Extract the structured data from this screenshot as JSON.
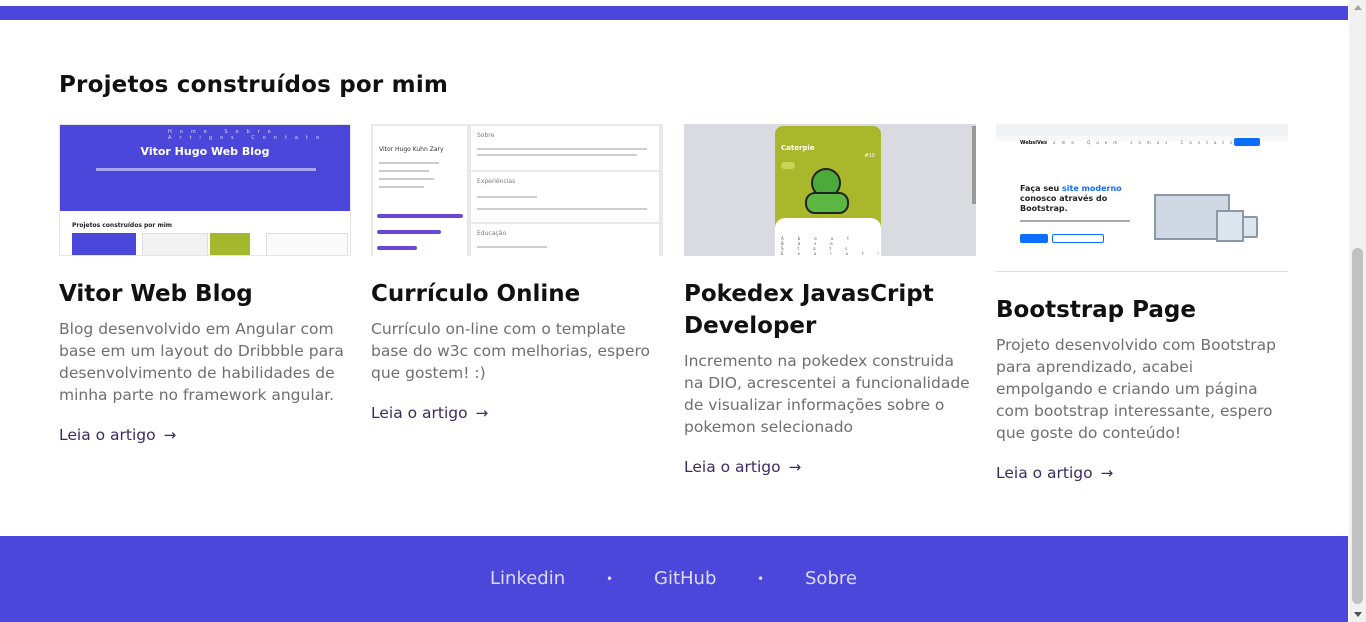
{
  "section": {
    "title": "Projetos construídos por mim"
  },
  "projects": [
    {
      "title": "Vitor Web Blog",
      "description": "Blog desenvolvido em Angular com base em um layout do Dribbble para desenvolvimento de habilidades de minha parte no framework angular.",
      "link_label": "Leia o artigo",
      "thumb": {
        "hero_title": "Vitor Hugo Web Blog",
        "section_heading": "Projetos construídos por mim",
        "nav": "Home Sobre Artigos Contato"
      }
    },
    {
      "title": "Currículo Online",
      "description": "Currículo on-line com o template base do w3c com melhorias, espero que gostem! :)",
      "link_label": "Leia o artigo",
      "thumb": {
        "name": "Vitor Hugo Kuhn Zary",
        "panel1": "Sobre",
        "panel2": "Experiências",
        "panel3": "Educação"
      }
    },
    {
      "title": "Pokedex JavasCript Developer",
      "description": "Incremento na pokedex construida na DIO, acrescentei a funcionalidade de visualizar informações sobre o pokemon selecionado",
      "link_label": "Leia o artigo",
      "thumb": {
        "pokemon": "Caterpie",
        "number": "#10",
        "tabs": "About Base Stats Evolution Moves"
      }
    },
    {
      "title": "Bootstrap Page",
      "description": "Projeto desenvolvido com Bootstrap para aprendizado, acabei empolgando e criando um página com bootstrap interessante, espero que goste do conteúdo!",
      "link_label": "Leia o artigo",
      "thumb": {
        "brand": "WebsiVes",
        "nav": "Home Quem somos Contato",
        "headline_pre": "Faça seu ",
        "headline_highlight": "site moderno",
        "headline_post": " conosco através do Bootstrap."
      }
    }
  ],
  "footer": {
    "links": [
      "Linkedin",
      "GitHub",
      "Sobre"
    ],
    "separator": "•"
  },
  "colors": {
    "brand": "#4b47da",
    "link": "#3a2a66",
    "muted": "#6f6f6f"
  },
  "icons": {
    "link_arrow": "→"
  }
}
